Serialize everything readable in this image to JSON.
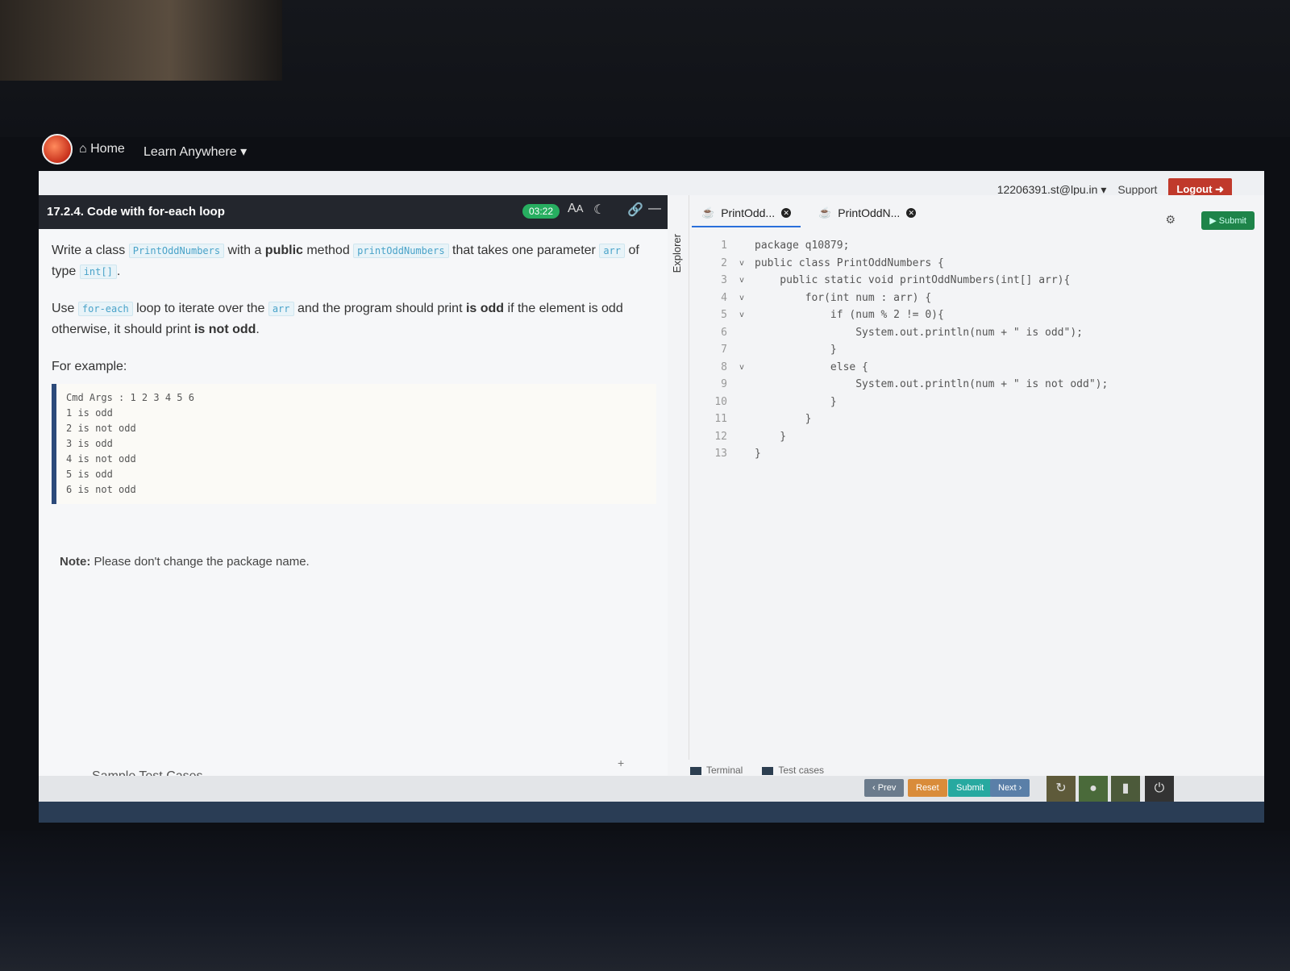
{
  "nav": {
    "home": "Home",
    "learn": "Learn Anywhere ▾"
  },
  "user": {
    "email": "12206391.st@lpu.in ▾",
    "support": "Support",
    "logout": "Logout"
  },
  "question": {
    "title": "17.2.4. Code with for-each loop",
    "timer": "03:22",
    "p1_a": "Write a class ",
    "p1_class": "PrintOddNumbers",
    "p1_b": " with a ",
    "p1_public": "public",
    "p1_c": " method ",
    "p1_method": "printOddNumbers",
    "p1_d": " that takes one parameter ",
    "p1_arr": "arr",
    "p1_e": " of type ",
    "p1_type": "int[]",
    "p1_f": ".",
    "p2_a": "Use ",
    "p2_foreach": "for-each",
    "p2_b": " loop to iterate over the ",
    "p2_arr": "arr",
    "p2_c": " and the program should print ",
    "p2_isodd": "is odd",
    "p2_d": " if the element is odd otherwise, it should print ",
    "p2_isnotodd": "is not odd",
    "p2_e": ".",
    "for_example": "For example:",
    "example_lines": [
      "Cmd Args : 1 2 3 4 5 6",
      "1 is odd",
      "2 is not odd",
      "3 is odd",
      "4 is not odd",
      "5 is odd",
      "6 is not odd"
    ],
    "note_label": "Note:",
    "note_text": " Please don't change the package name.",
    "sample_cases": "Sample Test Cases"
  },
  "editor": {
    "explorer": "Explorer",
    "tabs": [
      "PrintOdd...",
      "PrintOddN..."
    ],
    "run_label": "Submit",
    "code": [
      {
        "n": "1",
        "fold": "",
        "t": "package q10879;"
      },
      {
        "n": "2",
        "fold": "v",
        "t": "public class PrintOddNumbers {"
      },
      {
        "n": "3",
        "fold": "v",
        "t": "    public static void printOddNumbers(int[] arr){"
      },
      {
        "n": "4",
        "fold": "v",
        "t": "        for(int num : arr) {"
      },
      {
        "n": "5",
        "fold": "v",
        "t": "            if (num % 2 != 0){"
      },
      {
        "n": "6",
        "fold": "",
        "t": "                System.out.println(num + \" is odd\");"
      },
      {
        "n": "7",
        "fold": "",
        "t": "            }"
      },
      {
        "n": "8",
        "fold": "v",
        "t": "            else {"
      },
      {
        "n": "9",
        "fold": "",
        "t": "                System.out.println(num + \" is not odd\");"
      },
      {
        "n": "10",
        "fold": "",
        "t": "            }"
      },
      {
        "n": "11",
        "fold": "",
        "t": "        }"
      },
      {
        "n": "12",
        "fold": "",
        "t": "    }"
      },
      {
        "n": "13",
        "fold": "",
        "t": "}"
      }
    ],
    "terminal": "Terminal",
    "testcases": "Test cases"
  },
  "footer": {
    "prev": "‹ Prev",
    "reset": "Reset",
    "submit": "Submit",
    "next": "Next ›"
  }
}
